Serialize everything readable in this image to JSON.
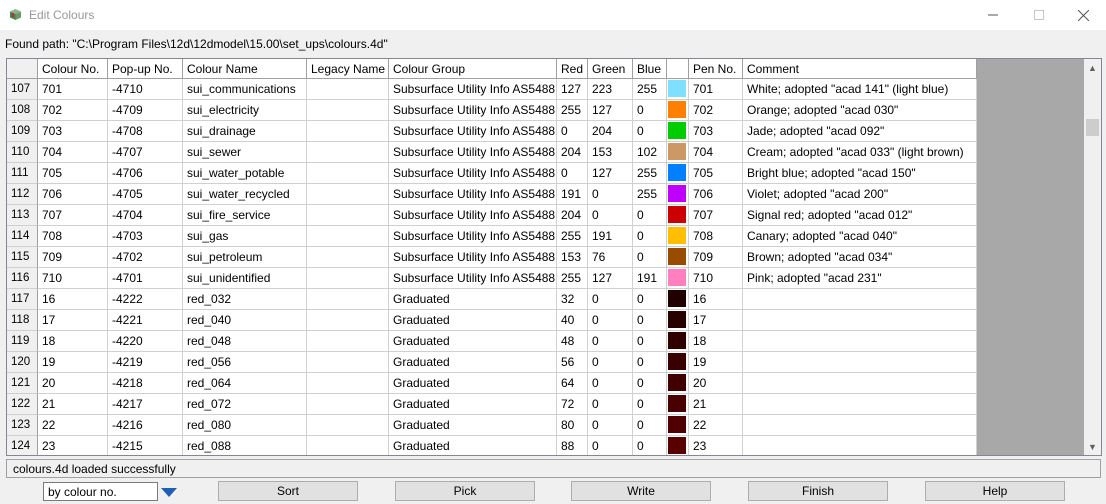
{
  "window": {
    "title": "Edit Colours"
  },
  "found_path": "Found path: \"C:\\Program Files\\12d\\12dmodel\\15.00\\set_ups\\colours.4d\"",
  "columns": [
    "Colour No.",
    "Pop-up No.",
    "Colour Name",
    "Legacy Name",
    "Colour Group",
    "Red",
    "Green",
    "Blue",
    "",
    "Pen No.",
    "Comment"
  ],
  "rows": [
    {
      "n": "107",
      "colour": "701",
      "popup": "-4710",
      "name": "sui_communications",
      "legacy": "",
      "group": "Subsurface Utility Info AS5488",
      "r": "127",
      "g": "223",
      "b": "255",
      "swatch": "#7fdfff",
      "pen": "701",
      "comment": "White; adopted \"acad 141\" (light blue)"
    },
    {
      "n": "108",
      "colour": "702",
      "popup": "-4709",
      "name": "sui_electricity",
      "legacy": "",
      "group": "Subsurface Utility Info AS5488",
      "r": "255",
      "g": "127",
      "b": "0",
      "swatch": "#ff7f00",
      "pen": "702",
      "comment": "Orange; adopted \"acad 030\""
    },
    {
      "n": "109",
      "colour": "703",
      "popup": "-4708",
      "name": "sui_drainage",
      "legacy": "",
      "group": "Subsurface Utility Info AS5488",
      "r": "0",
      "g": "204",
      "b": "0",
      "swatch": "#00cc00",
      "pen": "703",
      "comment": "Jade; adopted \"acad 092\""
    },
    {
      "n": "110",
      "colour": "704",
      "popup": "-4707",
      "name": "sui_sewer",
      "legacy": "",
      "group": "Subsurface Utility Info AS5488",
      "r": "204",
      "g": "153",
      "b": "102",
      "swatch": "#cc9966",
      "pen": "704",
      "comment": "Cream; adopted \"acad 033\" (light brown)"
    },
    {
      "n": "111",
      "colour": "705",
      "popup": "-4706",
      "name": "sui_water_potable",
      "legacy": "",
      "group": "Subsurface Utility Info AS5488",
      "r": "0",
      "g": "127",
      "b": "255",
      "swatch": "#007fff",
      "pen": "705",
      "comment": "Bright blue; adopted \"acad 150\""
    },
    {
      "n": "112",
      "colour": "706",
      "popup": "-4705",
      "name": "sui_water_recycled",
      "legacy": "",
      "group": "Subsurface Utility Info AS5488",
      "r": "191",
      "g": "0",
      "b": "255",
      "swatch": "#bf00ff",
      "pen": "706",
      "comment": "Violet; adopted \"acad 200\""
    },
    {
      "n": "113",
      "colour": "707",
      "popup": "-4704",
      "name": "sui_fire_service",
      "legacy": "",
      "group": "Subsurface Utility Info AS5488",
      "r": "204",
      "g": "0",
      "b": "0",
      "swatch": "#cc0000",
      "pen": "707",
      "comment": "Signal red; adopted \"acad 012\""
    },
    {
      "n": "114",
      "colour": "708",
      "popup": "-4703",
      "name": "sui_gas",
      "legacy": "",
      "group": "Subsurface Utility Info AS5488",
      "r": "255",
      "g": "191",
      "b": "0",
      "swatch": "#ffbf00",
      "pen": "708",
      "comment": "Canary; adopted \"acad 040\""
    },
    {
      "n": "115",
      "colour": "709",
      "popup": "-4702",
      "name": "sui_petroleum",
      "legacy": "",
      "group": "Subsurface Utility Info AS5488",
      "r": "153",
      "g": "76",
      "b": "0",
      "swatch": "#994c00",
      "pen": "709",
      "comment": "Brown; adopted \"acad 034\""
    },
    {
      "n": "116",
      "colour": "710",
      "popup": "-4701",
      "name": "sui_unidentified",
      "legacy": "",
      "group": "Subsurface Utility Info AS5488",
      "r": "255",
      "g": "127",
      "b": "191",
      "swatch": "#ff7fbf",
      "pen": "710",
      "comment": "Pink; adopted \"acad 231\""
    },
    {
      "n": "117",
      "colour": "16",
      "popup": "-4222",
      "name": "red_032",
      "legacy": "",
      "group": "Graduated",
      "r": "32",
      "g": "0",
      "b": "0",
      "swatch": "#200000",
      "pen": "16",
      "comment": ""
    },
    {
      "n": "118",
      "colour": "17",
      "popup": "-4221",
      "name": "red_040",
      "legacy": "",
      "group": "Graduated",
      "r": "40",
      "g": "0",
      "b": "0",
      "swatch": "#280000",
      "pen": "17",
      "comment": ""
    },
    {
      "n": "119",
      "colour": "18",
      "popup": "-4220",
      "name": "red_048",
      "legacy": "",
      "group": "Graduated",
      "r": "48",
      "g": "0",
      "b": "0",
      "swatch": "#300000",
      "pen": "18",
      "comment": ""
    },
    {
      "n": "120",
      "colour": "19",
      "popup": "-4219",
      "name": "red_056",
      "legacy": "",
      "group": "Graduated",
      "r": "56",
      "g": "0",
      "b": "0",
      "swatch": "#380000",
      "pen": "19",
      "comment": ""
    },
    {
      "n": "121",
      "colour": "20",
      "popup": "-4218",
      "name": "red_064",
      "legacy": "",
      "group": "Graduated",
      "r": "64",
      "g": "0",
      "b": "0",
      "swatch": "#400000",
      "pen": "20",
      "comment": ""
    },
    {
      "n": "122",
      "colour": "21",
      "popup": "-4217",
      "name": "red_072",
      "legacy": "",
      "group": "Graduated",
      "r": "72",
      "g": "0",
      "b": "0",
      "swatch": "#480000",
      "pen": "21",
      "comment": ""
    },
    {
      "n": "123",
      "colour": "22",
      "popup": "-4216",
      "name": "red_080",
      "legacy": "",
      "group": "Graduated",
      "r": "80",
      "g": "0",
      "b": "0",
      "swatch": "#500000",
      "pen": "22",
      "comment": ""
    },
    {
      "n": "124",
      "colour": "23",
      "popup": "-4215",
      "name": "red_088",
      "legacy": "",
      "group": "Graduated",
      "r": "88",
      "g": "0",
      "b": "0",
      "swatch": "#580000",
      "pen": "23",
      "comment": ""
    }
  ],
  "status": "colours.4d loaded successfully",
  "sort_select": {
    "value": "by colour no."
  },
  "buttons": {
    "sort": "Sort",
    "pick": "Pick",
    "write": "Write",
    "finish": "Finish",
    "help": "Help"
  }
}
